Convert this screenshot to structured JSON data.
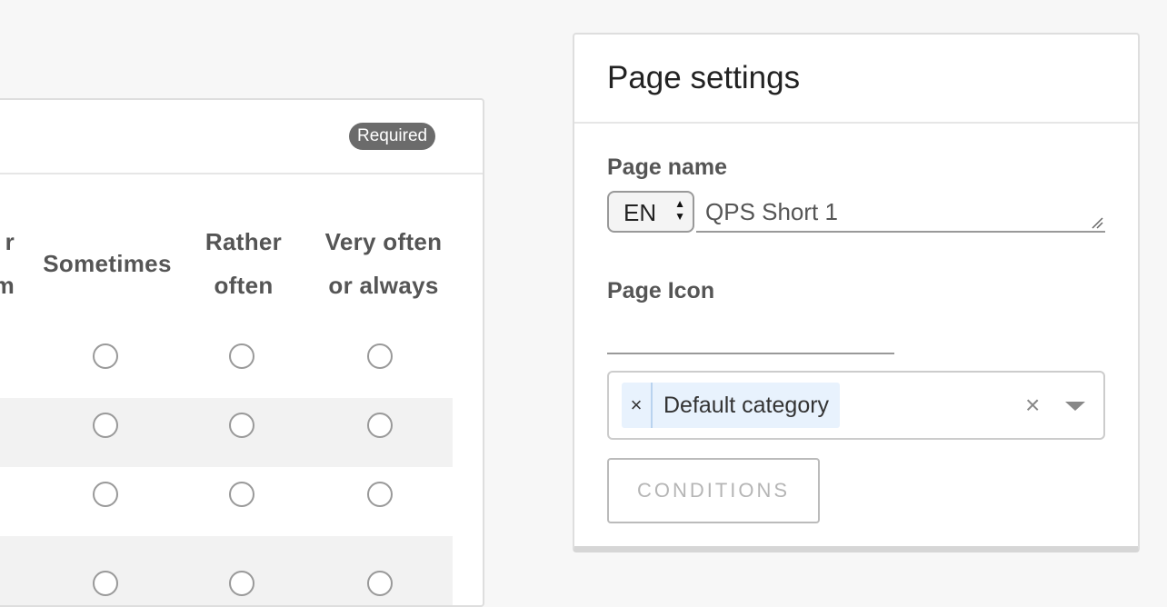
{
  "question": {
    "required_badge": "Required",
    "columns": [
      {
        "label_line1": "r",
        "label_line2": "m"
      },
      {
        "label": "Sometimes"
      },
      {
        "label_line1": "Rather",
        "label_line2": "often"
      },
      {
        "label_line1": "Very often",
        "label_line2": "or always"
      }
    ],
    "row_count_visible": 4
  },
  "page_settings": {
    "title": "Page settings",
    "page_name_label": "Page name",
    "language": "EN",
    "page_name_value": "QPS Short 1",
    "page_icon_label": "Page Icon",
    "category_tag": "Default category",
    "conditions_button": "CONDITIONS"
  },
  "icons": [
    "remove-tag-icon",
    "clear-icon",
    "dropdown-caret-icon",
    "select-arrows-icon",
    "resize-handle-icon"
  ]
}
